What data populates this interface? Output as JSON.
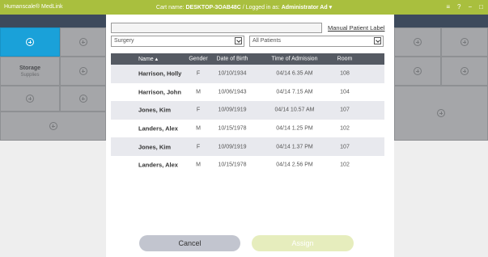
{
  "titlebar": {
    "app_name": "Humanscale® MedLink",
    "cart_label": "Cart name:",
    "cart_name": "DESKTOP-3OAB48C",
    "separator": "/",
    "logged_label": "Logged in as:",
    "user": "Administrator Ad",
    "user_caret": "▾",
    "window_controls": [
      "≡",
      "?",
      "−",
      "□"
    ]
  },
  "colors": {
    "titlebar": "#a9bf3e",
    "active_tile": "#1aa1d9",
    "table_header": "#555a63"
  },
  "tiles": {
    "storage_title": "Storage",
    "storage_sub": "Supplies"
  },
  "modal": {
    "manual_label_link": "Manual Patient Label",
    "department_select": "Surgery",
    "patients_select": "All Patients",
    "columns": {
      "name": "Name ▴",
      "gender": "Gender",
      "dob": "Date of Birth",
      "admission": "Time of Admission",
      "room": "Room"
    },
    "rows": [
      {
        "name": "Harrison, Holly",
        "gender": "F",
        "dob": "10/10/1934",
        "admission": "04/14 6.35 AM",
        "room": "108"
      },
      {
        "name": "Harrison, John",
        "gender": "M",
        "dob": "10/06/1943",
        "admission": "04/14 7.15 AM",
        "room": "104"
      },
      {
        "name": "Jones, Kim",
        "gender": "F",
        "dob": "10/09/1919",
        "admission": "04/14 10.57 AM",
        "room": "107"
      },
      {
        "name": "Landers, Alex",
        "gender": "M",
        "dob": "10/15/1978",
        "admission": "04/14 1.25 PM",
        "room": "102"
      },
      {
        "name": "Jones, Kim",
        "gender": "F",
        "dob": "10/09/1919",
        "admission": "04/14 1.37 PM",
        "room": "107"
      },
      {
        "name": "Landers, Alex",
        "gender": "M",
        "dob": "10/15/1978",
        "admission": "04/14 2.56 PM",
        "room": "102"
      }
    ],
    "cancel_label": "Cancel",
    "assign_label": "Assign"
  }
}
